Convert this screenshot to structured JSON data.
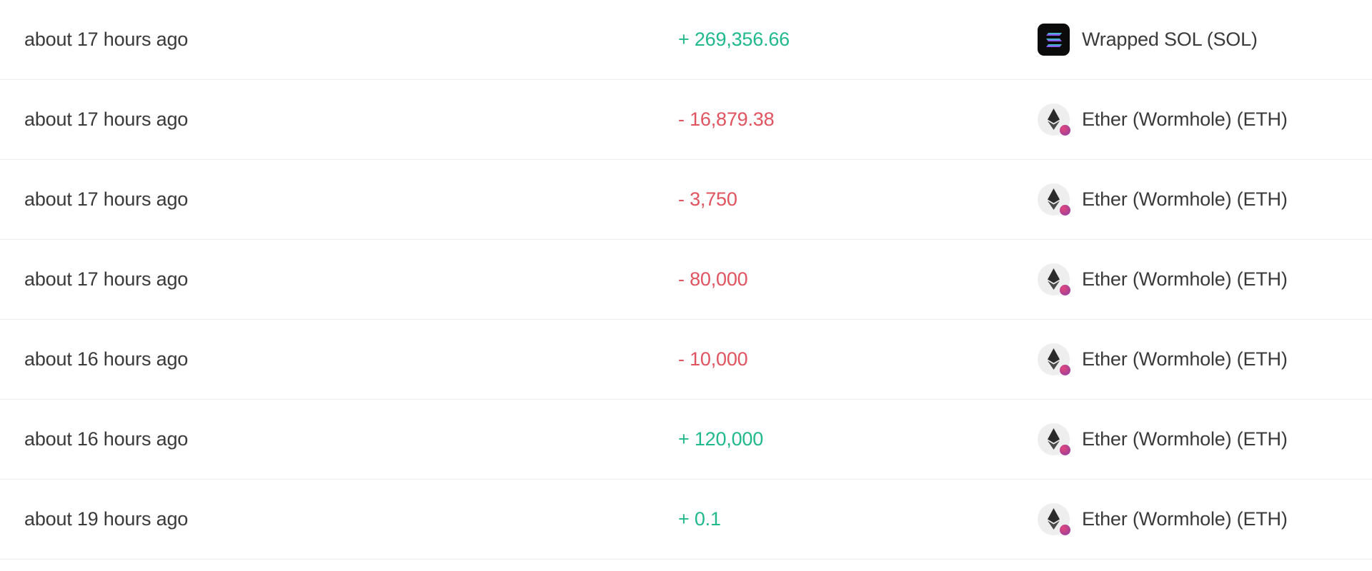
{
  "colors": {
    "positive": "#20b98c",
    "negative": "#e0535f",
    "text": "#3a3a3a"
  },
  "rows": [
    {
      "time": "about 17 hours ago",
      "amount": "+ 269,356.66",
      "direction": "positive",
      "token": "Wrapped SOL (SOL)",
      "token_icon": "solana-icon"
    },
    {
      "time": "about 17 hours ago",
      "amount": "- 16,879.38",
      "direction": "negative",
      "token": "Ether (Wormhole) (ETH)",
      "token_icon": "ethereum-wormhole-icon"
    },
    {
      "time": "about 17 hours ago",
      "amount": "- 3,750",
      "direction": "negative",
      "token": "Ether (Wormhole) (ETH)",
      "token_icon": "ethereum-wormhole-icon"
    },
    {
      "time": "about 17 hours ago",
      "amount": "- 80,000",
      "direction": "negative",
      "token": "Ether (Wormhole) (ETH)",
      "token_icon": "ethereum-wormhole-icon"
    },
    {
      "time": "about 16 hours ago",
      "amount": "- 10,000",
      "direction": "negative",
      "token": "Ether (Wormhole) (ETH)",
      "token_icon": "ethereum-wormhole-icon"
    },
    {
      "time": "about 16 hours ago",
      "amount": "+ 120,000",
      "direction": "positive",
      "token": "Ether (Wormhole) (ETH)",
      "token_icon": "ethereum-wormhole-icon"
    },
    {
      "time": "about 19 hours ago",
      "amount": "+ 0.1",
      "direction": "positive",
      "token": "Ether (Wormhole) (ETH)",
      "token_icon": "ethereum-wormhole-icon"
    }
  ]
}
